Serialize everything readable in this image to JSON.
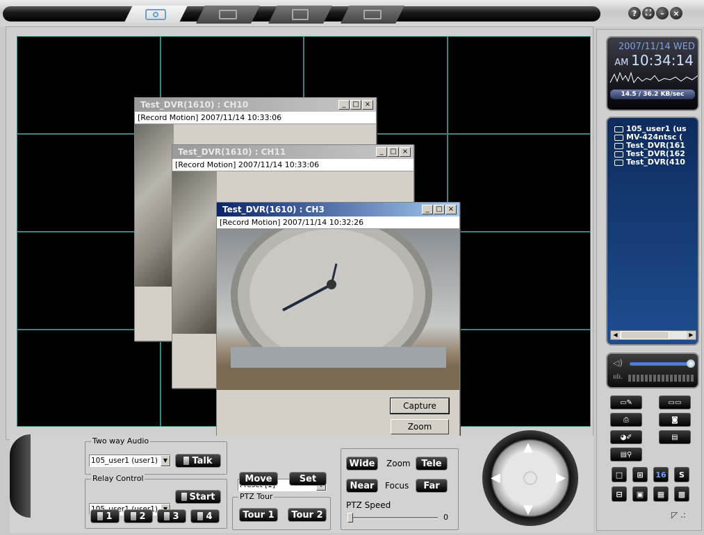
{
  "tabs": [
    {
      "name": "live-view",
      "icon": "camera-eye-icon",
      "active": true
    },
    {
      "name": "search",
      "icon": "search-dvr-icon",
      "active": false
    },
    {
      "name": "remote",
      "icon": "monitor-search-icon",
      "active": false
    },
    {
      "name": "setup",
      "icon": "settings-tool-icon",
      "active": false
    }
  ],
  "window_buttons": {
    "help": "?",
    "maximize": "⛶",
    "minimize": "–",
    "close": "×"
  },
  "camera_windows": [
    {
      "title": "Test_DVR(1610) : CH10",
      "status": "[Record Motion] 2007/11/14 10:33:06"
    },
    {
      "title": "Test_DVR(1610) : CH11",
      "status": "[Record Motion] 2007/11/14 10:33:06"
    },
    {
      "title": "Test_DVR(1610) : CH3",
      "status": "[Record Motion] 2007/11/14 10:32:26"
    }
  ],
  "ch3_buttons": {
    "capture": "Capture",
    "zoom": "Zoom"
  },
  "clock": {
    "date": "2007/11/14 WED",
    "ampm": "AM",
    "time": "10:34:14",
    "rate": "14.5 / 36.2 KB/sec"
  },
  "devices": [
    "105_user1 (us",
    "MV-424ntsc (",
    "Test_DVR(161",
    "Test_DVR(162",
    "Test_DVR(410"
  ],
  "volume": {
    "level": 0.85
  },
  "layout_buttons": [
    "16",
    "S"
  ],
  "audio": {
    "legend": "Two way Audio",
    "selected": "105_user1 (user1)",
    "talk": "Talk"
  },
  "relay": {
    "legend": "Relay Control",
    "selected": "105_user1 (user1)",
    "start": "Start",
    "buttons": [
      "1",
      "2",
      "3",
      "4"
    ]
  },
  "preset": {
    "selected": "Preset [1]",
    "move": "Move",
    "set": "Set"
  },
  "tour": {
    "legend": "PTZ Tour",
    "tour1": "Tour 1",
    "tour2": "Tour 2"
  },
  "zoom": {
    "wide": "Wide",
    "label": "Zoom",
    "tele": "Tele"
  },
  "focus": {
    "near": "Near",
    "label": "Focus",
    "far": "Far"
  },
  "ptz_speed": {
    "label": "PTZ Speed",
    "value": "0"
  }
}
